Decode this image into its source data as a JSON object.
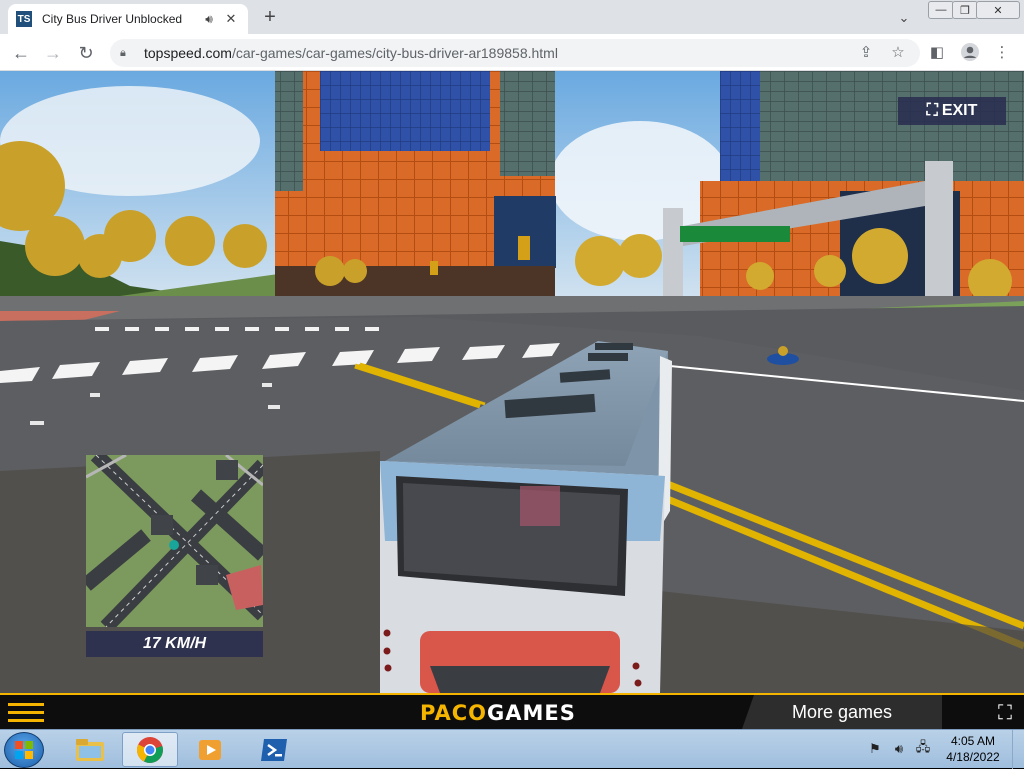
{
  "browser": {
    "tab": {
      "favicon_text": "TS",
      "title": "City Bus Driver Unblocked",
      "audio_icon": "speaker-icon",
      "close_icon": "close-icon"
    },
    "new_tab_icon": "plus-icon",
    "address": {
      "url_host": "topspeed.com",
      "url_path": "/car-games/car-games/city-bus-driver-ar189858.html"
    }
  },
  "game": {
    "exit_label": "EXIT",
    "speed": "17 KM/H"
  },
  "gamebar": {
    "logo_left": "PACO",
    "logo_right": "GAMES",
    "more_games": "More games"
  },
  "taskbar": {
    "time": "4:05 AM",
    "date": "4/18/2022"
  },
  "colors": {
    "accent": "#f4b400",
    "hud_bg": "#282d50",
    "sky": "#7fb8e6",
    "road": "#5a5b5e"
  }
}
